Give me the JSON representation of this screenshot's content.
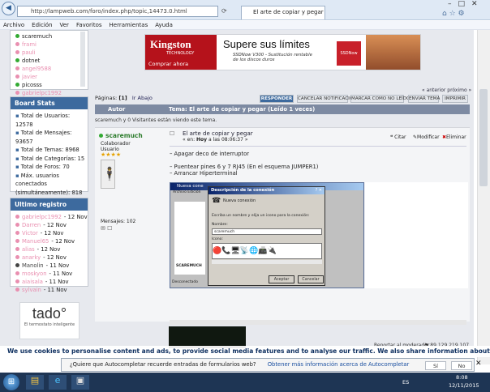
{
  "browser": {
    "url": "http://lampweb.com/foro/index.php/topic,14473.0.html",
    "tab_title": "El arte de copiar y pegar",
    "menu": [
      "Archivo",
      "Edición",
      "Ver",
      "Favoritos",
      "Herramientas",
      "Ayuda"
    ]
  },
  "sidebar": {
    "online_users": [
      "scaremuch",
      "frami",
      "pauli",
      "dotnet",
      "angel9588",
      "javier",
      "picosss",
      "gabrielpc1992"
    ],
    "stats": {
      "title": "Board Stats",
      "lines": [
        "Total de Usuarios:",
        "12578",
        "Total de Mensajes:",
        "93657",
        "Total de Temas: 8968",
        "Total de Categorías: 15",
        "Total de Foros: 70",
        "Máx. usuarios",
        "conectados",
        "(simultáneamente): 818"
      ]
    },
    "registry": {
      "title": "Ultimo registro",
      "items": [
        {
          "name": "gabrielpc1992",
          "date": "- 12 Nov",
          "color": "#e98fb0"
        },
        {
          "name": "Darren",
          "date": "- 12 Nov",
          "color": "#e98fb0"
        },
        {
          "name": "Victor",
          "date": "- 12 Nov",
          "color": "#e98fb0"
        },
        {
          "name": "Manuel65",
          "date": "- 12 Nov",
          "color": "#e98fb0"
        },
        {
          "name": "alias",
          "date": "- 12 Nov",
          "color": "#e98fb0"
        },
        {
          "name": "anarky",
          "date": "- 12 Nov",
          "color": "#e98fb0"
        },
        {
          "name": "Manolin",
          "date": "- 11 Nov",
          "color": "#444444"
        },
        {
          "name": "moskyon",
          "date": "- 11 Nov",
          "color": "#e98fb0"
        },
        {
          "name": "aiaisala",
          "date": "- 11 Nov",
          "color": "#e98fb0"
        },
        {
          "name": "sylvain",
          "date": "- 11 Nov",
          "color": "#e98fb0"
        }
      ]
    },
    "tado": {
      "logo": "tado°",
      "tagline": "El termostato inteligente"
    }
  },
  "ad": {
    "brand": "Kingston",
    "brand_sub": "TECHNOLOGY",
    "cta": "Comprar ahora",
    "headline": "Supere sus límites",
    "sub": "SSDNow V300 - Sustitución rentable de los discos duros",
    "tile": "SSDNow"
  },
  "pagination": {
    "label": "Páginas:",
    "current": "[1]",
    "up": "Ir Abajo"
  },
  "actions": [
    "RESPONDER",
    "CANCELAR NOTIFICACIÓN",
    "MARCAR COMO NO LEÍDOS",
    "ENVIAR TEMA",
    "IMPRIMIR"
  ],
  "prev_next": "« anterior próximo »",
  "topic_header": {
    "author": "Autor",
    "topic": "Tema: El arte de copiar y pegar  (Leído 1 veces)"
  },
  "viewing": "scaremuch y 0 Visitantes están viendo este tema.",
  "post": {
    "author": "scaremuch",
    "rank": "Colaborador",
    "group": "Usuario",
    "stars": "★★★★",
    "messages": "Mensajes: 102",
    "title": "El arte de copiar y pegar",
    "date_prefix": "« en:",
    "date_bold": "Hoy",
    "date_time": "a las 08:06:37 »",
    "citar": "Citar",
    "modificar": "Modificar",
    "eliminar": "Eliminar",
    "body": [
      "– Apagar deco de interruptor",
      "",
      "– Puentear pines 6 y 7 RJ45 (En el esquema JUMPER1)",
      "– Arrancar Hiperterminal"
    ],
    "report": "Reportar al moderador",
    "ip": "89.129.219.107"
  },
  "dialog": {
    "outer_title": "Nueva cone",
    "outer_menu": "Archivo  Edición",
    "outer_label": "SCAREMUCH",
    "outer_status": "Desconectado",
    "title": "Descripción de la conexión",
    "header": "Nueva conexión",
    "prompt": "Escriba un nombre y elija un icono para la conexión:",
    "name_label": "Nombre:",
    "name_value": "scaremuch",
    "icon_label": "Icono:",
    "accept": "Aceptar",
    "cancel": "Cancelar"
  },
  "cookie_text": "We use cookies to personalise content and ads, to provide social media features and to analyse our traffic. We also share information about your use of our site with our social media,",
  "autocomplete": {
    "question": "¿Quiere que Autocompletar recuerde entradas de formularios web?",
    "link": "Obtener más información acerca de Autocompletar",
    "yes": "Sí",
    "no": "No"
  },
  "taskbar": {
    "lang": "ES",
    "time": "8:08",
    "date": "12/11/2015"
  }
}
